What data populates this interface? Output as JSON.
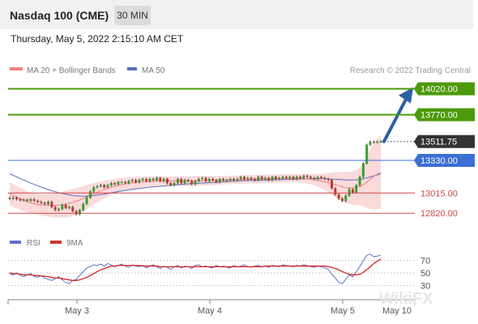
{
  "header": {
    "title": "Nasdaq 100 (CME)",
    "interval": "30 MIN",
    "datetime": "Thursday, May 5, 2022 2:15:10 AM CET"
  },
  "legend": {
    "ma20": "MA 20 + Bollinger Bands",
    "ma50": "MA 50",
    "credit": "Research © 2022 Trading Central"
  },
  "rsi_legend": {
    "rsi": "RSI",
    "ma": "9MA"
  },
  "watermark": "WikiFX",
  "colors": {
    "bull": "#33a02c",
    "bear": "#c0392b",
    "band": "#f9d4d4",
    "ma20": "#f08080",
    "ma50": "#5a6fb5",
    "resistance": "#4c9a0a",
    "pivot": "#3b6fd4",
    "support": "#d04848",
    "arrow": "#2d5fa3",
    "current": "#333333",
    "rsi": "#5b73c9",
    "rsi_ma": "#d43030"
  },
  "chart_data": [
    {
      "type": "line",
      "title": "",
      "xlabel": "",
      "ylabel": "",
      "x_ticks": [
        "May 3",
        "May 4",
        "May 5",
        "May 10"
      ],
      "ylim": [
        12650,
        14150
      ],
      "current_price": "13511.75",
      "levels": [
        {
          "label": "14020.00",
          "value": 14020,
          "kind": "resistance"
        },
        {
          "label": "13770.00",
          "value": 13770,
          "kind": "resistance"
        },
        {
          "label": "13330.00",
          "value": 13330,
          "kind": "pivot"
        },
        {
          "label": "13015.00",
          "value": 13015,
          "kind": "support"
        },
        {
          "label": "12820.00",
          "value": 12820,
          "kind": "support"
        }
      ],
      "candles": {
        "close": [
          12960,
          12970,
          12955,
          12945,
          12950,
          12940,
          12955,
          12940,
          12930,
          12920,
          12910,
          12930,
          12880,
          12850,
          12860,
          12900,
          12870,
          12880,
          12840,
          12810,
          12850,
          12910,
          12970,
          13030,
          13070,
          13080,
          13090,
          13070,
          13090,
          13110,
          13100,
          13120,
          13120,
          13110,
          13130,
          13140,
          13120,
          13140,
          13150,
          13130,
          13150,
          13140,
          13160,
          13130,
          13150,
          13110,
          13090,
          13110,
          13150,
          13110,
          13140,
          13130,
          13100,
          13130,
          13150,
          13160,
          13130,
          13150,
          13140,
          13120,
          13150,
          13140,
          13140,
          13150,
          13140,
          13150,
          13170,
          13150,
          13160,
          13150,
          13140,
          13170,
          13150,
          13160,
          13140,
          13170,
          13150,
          13160,
          13170,
          13160,
          13170,
          13150,
          13170,
          13160,
          13180,
          13170,
          13160,
          13150,
          13170,
          13160,
          13150,
          13140,
          13060,
          13000,
          12960,
          12940,
          12990,
          13050,
          13020,
          13090,
          13170,
          13300,
          13480,
          13510,
          13505,
          13510,
          13512
        ],
        "open_offset": 0
      },
      "ma20": [
        13010,
        12990,
        12975,
        12960,
        12945,
        12930,
        12920,
        12912,
        12905,
        12900,
        12897,
        12895,
        12894,
        12895,
        12898,
        12902,
        12908,
        12915,
        12925,
        12936,
        12948,
        12962,
        12976,
        12992,
        13008,
        13022,
        13035,
        13048,
        13060,
        13070,
        13080,
        13088,
        13096,
        13102,
        13108,
        13112,
        13116,
        13119,
        13122,
        13124,
        13126,
        13128,
        13130,
        13131,
        13132,
        13132,
        13131,
        13131,
        13131,
        13131,
        13131,
        13131,
        13131,
        13131,
        13132,
        13133,
        13134,
        13135,
        13136,
        13137,
        13138,
        13139,
        13140,
        13141,
        13142,
        13143,
        13144,
        13145,
        13146,
        13147,
        13148,
        13149,
        13150,
        13151,
        13152,
        13153,
        13154,
        13155,
        13156,
        13157,
        13158,
        13158,
        13158,
        13157,
        13155,
        13152,
        13148,
        13143,
        13137,
        13130,
        13123,
        13115,
        13105,
        13095,
        13085,
        13075,
        13068,
        13064,
        13064,
        13068,
        13078,
        13095,
        13120,
        13148,
        13175,
        13198,
        13215
      ],
      "ma50": [
        13200,
        13185,
        13170,
        13155,
        13140,
        13126,
        13112,
        13098,
        13085,
        13072,
        13060,
        13048,
        13037,
        13027,
        13018,
        13010,
        13003,
        12997,
        12992,
        12988,
        12986,
        12985,
        12986,
        12988,
        12991,
        12995,
        13000,
        13005,
        13011,
        13017,
        13023,
        13029,
        13035,
        13040,
        13045,
        13050,
        13055,
        13059,
        13063,
        13067,
        13071,
        13074,
        13077,
        13080,
        13083,
        13086,
        13089,
        13092,
        13095,
        13098,
        13101,
        13103,
        13105,
        13107,
        13109,
        13111,
        13113,
        13115,
        13117,
        13119,
        13121,
        13123,
        13125,
        13127,
        13129,
        13131,
        13133,
        13134,
        13135,
        13136,
        13137,
        13138,
        13139,
        13140,
        13141,
        13142,
        13143,
        13144,
        13145,
        13146,
        13147,
        13148,
        13149,
        13150,
        13151,
        13152,
        13153,
        13153,
        13153,
        13153,
        13152,
        13151,
        13149,
        13147,
        13145,
        13143,
        13141,
        13140,
        13140,
        13142,
        13146,
        13152,
        13160,
        13170,
        13180,
        13190,
        13200
      ],
      "bb_width": [
        110,
        110,
        108,
        106,
        104,
        102,
        100,
        100,
        100,
        102,
        105,
        108,
        112,
        116,
        120,
        124,
        128,
        130,
        130,
        128,
        124,
        120,
        116,
        110,
        104,
        98,
        92,
        86,
        80,
        76,
        72,
        68,
        64,
        62,
        60,
        58,
        56,
        54,
        52,
        50,
        48,
        47,
        46,
        45,
        44,
        44,
        44,
        45,
        46,
        47,
        48,
        48,
        48,
        48,
        48,
        47,
        46,
        45,
        44,
        43,
        42,
        41,
        40,
        40,
        40,
        40,
        40,
        40,
        40,
        40,
        40,
        40,
        40,
        40,
        40,
        40,
        40,
        40,
        40,
        40,
        40,
        40,
        40,
        41,
        43,
        46,
        50,
        55,
        62,
        70,
        80,
        92,
        106,
        120,
        132,
        142,
        150,
        156,
        160,
        166,
        180,
        210,
        250,
        290,
        320,
        340,
        350
      ],
      "projection": {
        "from": 13511.75,
        "to": 14020
      }
    },
    {
      "type": "line",
      "title": "",
      "ylim": [
        10,
        90
      ],
      "y_ticks": [
        70,
        50,
        30
      ],
      "series": [
        {
          "name": "RSI",
          "values": [
            48,
            47,
            50,
            46,
            44,
            47,
            49,
            45,
            43,
            46,
            42,
            40,
            38,
            41,
            44,
            39,
            35,
            33,
            38,
            40,
            46,
            52,
            58,
            60,
            63,
            62,
            64,
            61,
            65,
            63,
            60,
            62,
            64,
            61,
            59,
            63,
            61,
            60,
            62,
            58,
            61,
            63,
            60,
            57,
            61,
            59,
            56,
            60,
            62,
            58,
            61,
            60,
            57,
            62,
            63,
            60,
            61,
            59,
            58,
            62,
            60,
            61,
            59,
            58,
            62,
            60,
            61,
            63,
            60,
            59,
            61,
            62,
            60,
            61,
            59,
            62,
            61,
            60,
            63,
            62,
            61,
            60,
            62,
            61,
            63,
            62,
            60,
            59,
            61,
            60,
            58,
            56,
            48,
            42,
            35,
            33,
            40,
            47,
            44,
            52,
            60,
            70,
            78,
            80,
            76,
            77,
            78
          ]
        },
        {
          "name": "9MA",
          "values": [
            50,
            49,
            49,
            48,
            47,
            47,
            47,
            46,
            46,
            45,
            45,
            44,
            43,
            42,
            42,
            41,
            40,
            39,
            38,
            38,
            39,
            41,
            43,
            46,
            49,
            52,
            55,
            57,
            59,
            61,
            61,
            62,
            62,
            62,
            62,
            62,
            62,
            62,
            61,
            61,
            61,
            61,
            61,
            60,
            60,
            60,
            60,
            60,
            60,
            60,
            60,
            60,
            60,
            60,
            60,
            60,
            60,
            60,
            60,
            60,
            60,
            60,
            60,
            60,
            60,
            60,
            60,
            60,
            60,
            60,
            60,
            60,
            60,
            61,
            61,
            61,
            61,
            61,
            61,
            61,
            61,
            61,
            61,
            61,
            61,
            61,
            61,
            61,
            61,
            61,
            61,
            60,
            59,
            57,
            55,
            52,
            50,
            48,
            47,
            47,
            48,
            51,
            55,
            60,
            65,
            69,
            72
          ]
        }
      ]
    }
  ]
}
